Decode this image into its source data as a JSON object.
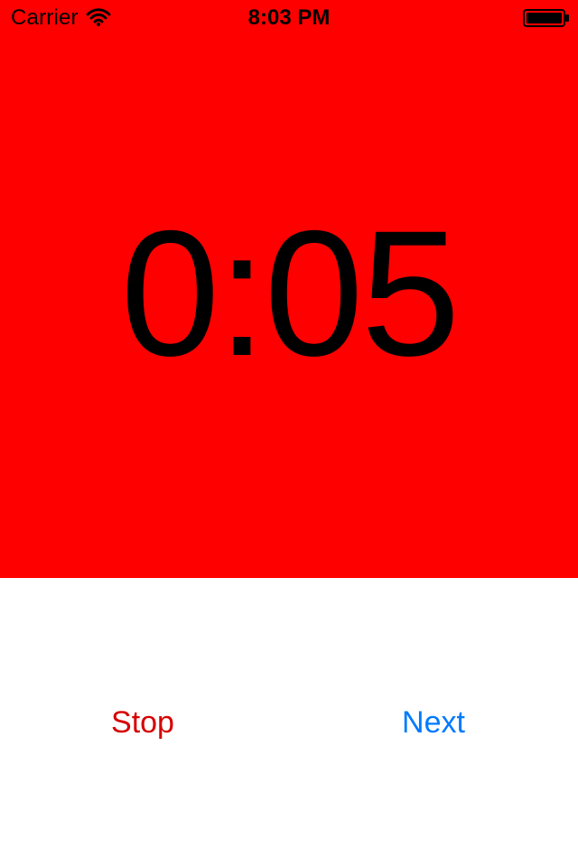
{
  "status_bar": {
    "carrier": "Carrier",
    "time": "8:03 PM",
    "icons": {
      "wifi": "wifi-icon",
      "battery": "battery-icon"
    }
  },
  "timer": {
    "value": "0:05",
    "background_color": "#ff0000",
    "text_color": "#000000"
  },
  "controls": {
    "stop_label": "Stop",
    "next_label": "Next",
    "stop_color": "#d60000",
    "next_color": "#007aff"
  }
}
